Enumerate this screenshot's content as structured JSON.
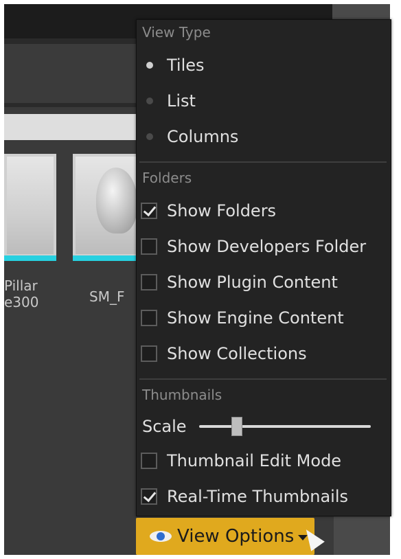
{
  "assets": [
    {
      "label_line1": "Pillar",
      "label_line2": "e300"
    },
    {
      "label_line1": "SM_F",
      "label_line2": ""
    }
  ],
  "menu": {
    "view_type": {
      "title": "View Type",
      "options": [
        {
          "label": "Tiles",
          "selected": true
        },
        {
          "label": "List",
          "selected": false
        },
        {
          "label": "Columns",
          "selected": false
        }
      ]
    },
    "folders": {
      "title": "Folders",
      "items": [
        {
          "label": "Show Folders",
          "checked": true
        },
        {
          "label": "Show Developers Folder",
          "checked": false
        },
        {
          "label": "Show Plugin Content",
          "checked": false
        },
        {
          "label": "Show Engine Content",
          "checked": false
        },
        {
          "label": "Show Collections",
          "checked": false
        }
      ]
    },
    "thumbnails": {
      "title": "Thumbnails",
      "scale_label": "Scale",
      "scale_value": 0.2,
      "items": [
        {
          "label": "Thumbnail Edit Mode",
          "checked": false
        },
        {
          "label": "Real-Time Thumbnails",
          "checked": true
        }
      ]
    }
  },
  "view_options_button": {
    "label": "View Options",
    "icon": "eye-icon"
  },
  "colors": {
    "accent": "#e0a91e",
    "thumbnail_bar": "#27d0e0"
  }
}
